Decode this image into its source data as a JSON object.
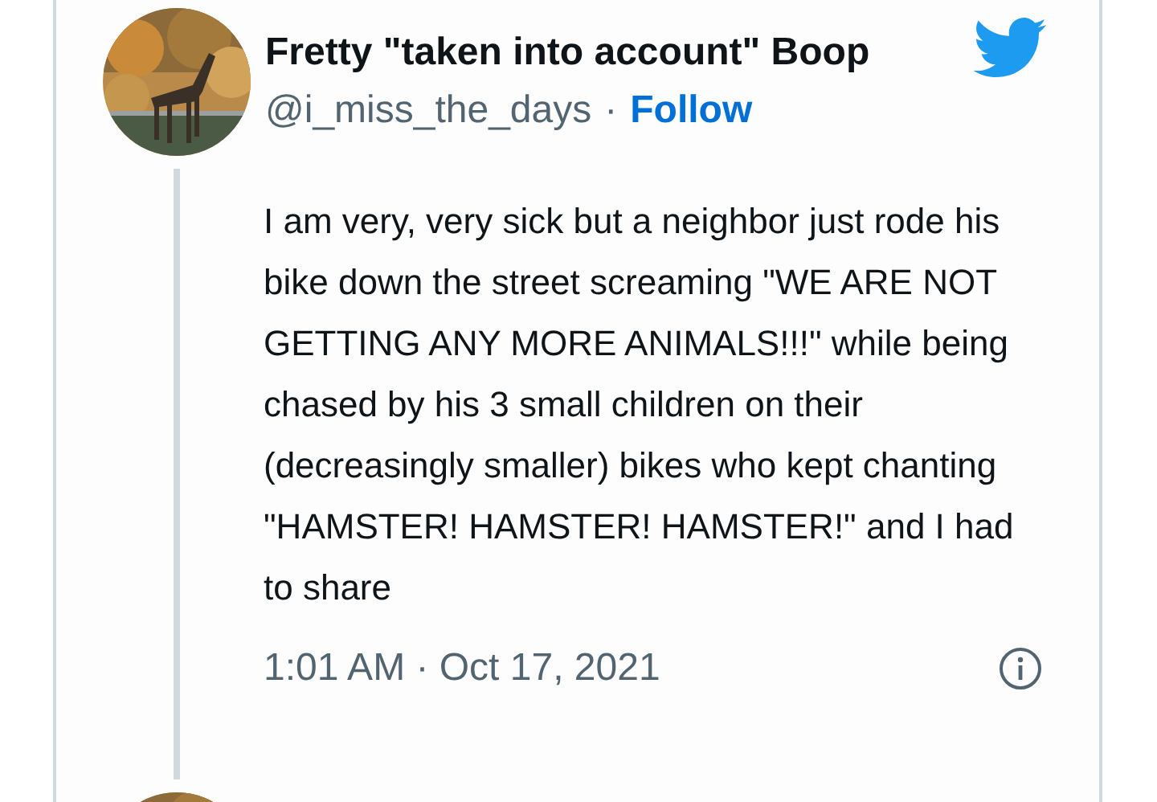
{
  "tweet": {
    "author": {
      "name": "Fretty \"taken into account\" Boop",
      "handle": "@i_miss_the_days",
      "separator": "·",
      "follow": "Follow"
    },
    "text": "I am very, very sick but a neighbor just rode his bike down the street screaming \"WE ARE NOT GETTING ANY MORE ANIMALS!!!\" while being chased by his 3 small children on their (decreasingly smaller) bikes who kept chanting \"HAMSTER! HAMSTER! HAMSTER!\" and I had to share",
    "timestamp": "1:01 AM · Oct 17, 2021"
  }
}
